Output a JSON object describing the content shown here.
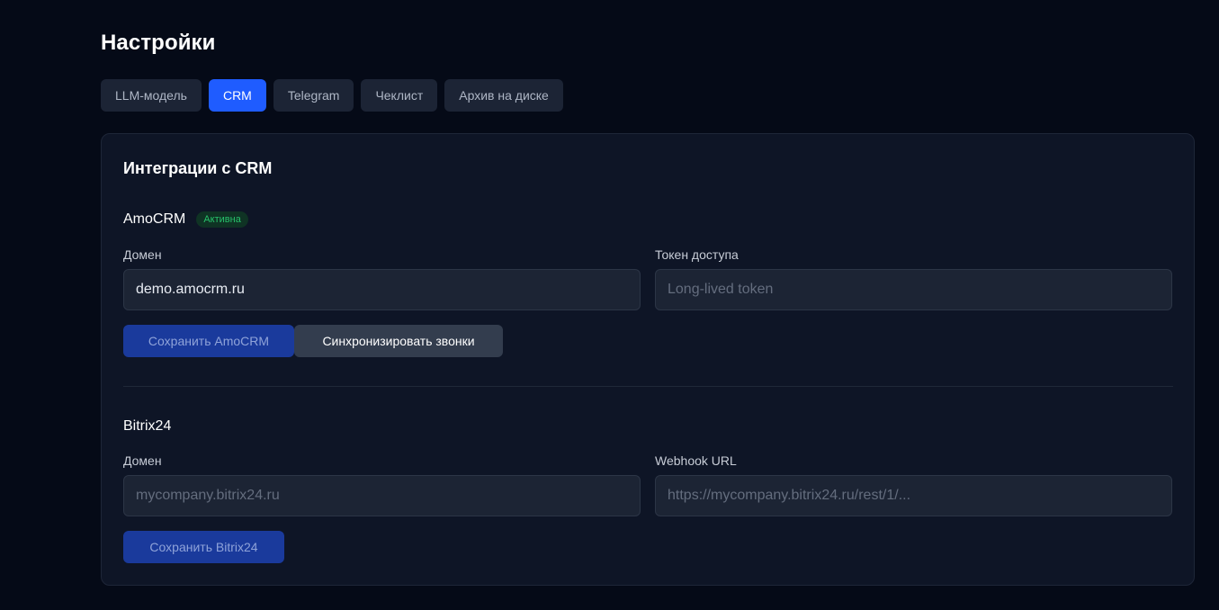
{
  "page": {
    "title": "Настройки"
  },
  "tabs": [
    {
      "label": "LLM-модель",
      "active": false
    },
    {
      "label": "CRM",
      "active": true
    },
    {
      "label": "Telegram",
      "active": false
    },
    {
      "label": "Чеклист",
      "active": false
    },
    {
      "label": "Архив на диске",
      "active": false
    }
  ],
  "card": {
    "title": "Интеграции с CRM"
  },
  "amocrm": {
    "name": "AmoCRM",
    "status": "Активна",
    "domain_label": "Домен",
    "domain_value": "demo.amocrm.ru",
    "domain_placeholder": "",
    "token_label": "Токен доступа",
    "token_value": "",
    "token_placeholder": "Long-lived token",
    "save_label": "Сохранить AmoCRM",
    "sync_label": "Синхронизировать звонки"
  },
  "bitrix": {
    "name": "Bitrix24",
    "domain_label": "Домен",
    "domain_value": "",
    "domain_placeholder": "mycompany.bitrix24.ru",
    "webhook_label": "Webhook URL",
    "webhook_value": "",
    "webhook_placeholder": "https://mycompany.bitrix24.ru/rest/1/...",
    "save_label": "Сохранить Bitrix24"
  },
  "colors": {
    "background": "#050a17",
    "accent": "#1f5cff",
    "active_badge": "#27c06a"
  }
}
